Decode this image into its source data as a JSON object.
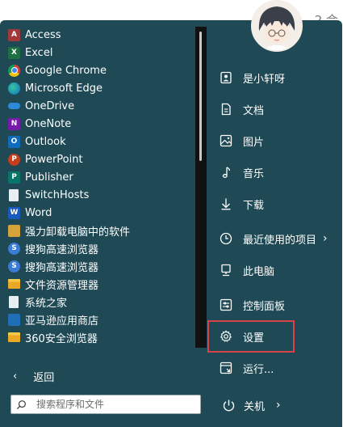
{
  "background": {
    "corner_text": "2 会"
  },
  "apps": [
    {
      "label": "Access",
      "icon": "access-icon",
      "glyph": "A"
    },
    {
      "label": "Excel",
      "icon": "excel-icon",
      "glyph": "X"
    },
    {
      "label": "Google Chrome",
      "icon": "chrome-icon",
      "glyph": ""
    },
    {
      "label": "Microsoft Edge",
      "icon": "edge-icon",
      "glyph": ""
    },
    {
      "label": "OneDrive",
      "icon": "onedrive-icon",
      "glyph": ""
    },
    {
      "label": "OneNote",
      "icon": "onenote-icon",
      "glyph": "N"
    },
    {
      "label": "Outlook",
      "icon": "outlook-icon",
      "glyph": "O"
    },
    {
      "label": "PowerPoint",
      "icon": "powerpoint-icon",
      "glyph": "P"
    },
    {
      "label": "Publisher",
      "icon": "publisher-icon",
      "glyph": "P"
    },
    {
      "label": "SwitchHosts",
      "icon": "document-icon",
      "glyph": ""
    },
    {
      "label": "Word",
      "icon": "word-icon",
      "glyph": "W"
    },
    {
      "label": "强力卸载电脑中的软件",
      "icon": "uninstaller-box-icon",
      "glyph": ""
    },
    {
      "label": "搜狗高速浏览器",
      "icon": "sogou-browser-icon",
      "glyph": "S"
    },
    {
      "label": "搜狗高速浏览器",
      "icon": "sogou-browser-icon",
      "glyph": "S"
    },
    {
      "label": "文件资源管理器",
      "icon": "folder-icon",
      "glyph": ""
    },
    {
      "label": "系统之家",
      "icon": "document-icon",
      "glyph": ""
    },
    {
      "label": "亚马逊应用商店",
      "icon": "amazon-store-icon",
      "glyph": ""
    },
    {
      "label": "360安全浏览器",
      "icon": "folder-icon",
      "glyph": ""
    }
  ],
  "back": {
    "label": "返回"
  },
  "search": {
    "placeholder": "搜索程序和文件"
  },
  "user": {
    "avatar": "avatar"
  },
  "places": [
    {
      "label": "是小轩呀",
      "icon": "user-folder-icon"
    },
    {
      "label": "文档",
      "icon": "document-icon"
    },
    {
      "label": "图片",
      "icon": "picture-icon"
    },
    {
      "label": "音乐",
      "icon": "music-note-icon"
    },
    {
      "label": "下载",
      "icon": "download-arrow-icon"
    },
    {
      "label": "最近使用的项目",
      "icon": "clock-icon",
      "arrow": "›"
    },
    {
      "label": "此电脑",
      "icon": "computer-icon"
    },
    {
      "label": "控制面板",
      "icon": "control-panel-icon"
    },
    {
      "label": "设置",
      "icon": "gear-icon"
    },
    {
      "label": "运行...",
      "icon": "run-icon"
    }
  ],
  "power": {
    "label": "关机",
    "arrow": "›"
  },
  "colors": {
    "menu_bg": "#1f4a55",
    "highlight_border": "#d64545"
  }
}
